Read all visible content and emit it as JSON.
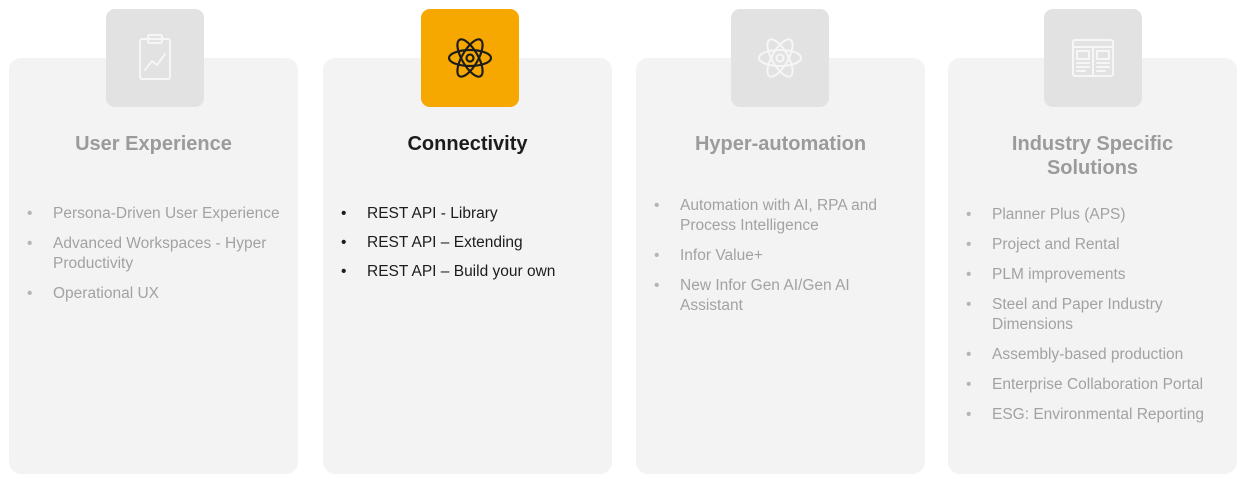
{
  "colors": {
    "card_background": "#f3f3f3",
    "inactive_icon_tile": "#e2e2e2",
    "active_icon_tile": "#f6a800",
    "active_text": "#1c1c1c",
    "inactive_text": "#9b9b9b"
  },
  "cards": [
    {
      "title": "User Experience",
      "icon": "clipboard-chart-icon",
      "active": false,
      "items": [
        "Persona-Driven User Experience",
        "Advanced Workspaces - Hyper Productivity",
        "Operational UX"
      ]
    },
    {
      "title": "Connectivity",
      "icon": "atom-icon",
      "active": true,
      "items": [
        "REST API - Library",
        "REST API – Extending",
        "REST API – Build your own"
      ]
    },
    {
      "title": "Hyper-automation",
      "icon": "atom-icon",
      "active": false,
      "items": [
        "Automation with AI, RPA and Process Intelligence",
        "Infor Value+",
        "New Infor Gen AI/Gen AI Assistant"
      ]
    },
    {
      "title": "Industry Specific Solutions",
      "icon": "document-layout-icon",
      "active": false,
      "items": [
        "Planner Plus (APS)",
        "Project and Rental",
        "PLM improvements",
        "Steel and Paper Industry Dimensions",
        "Assembly-based production",
        "Enterprise Collaboration Portal",
        "ESG: Environmental Reporting"
      ]
    }
  ]
}
